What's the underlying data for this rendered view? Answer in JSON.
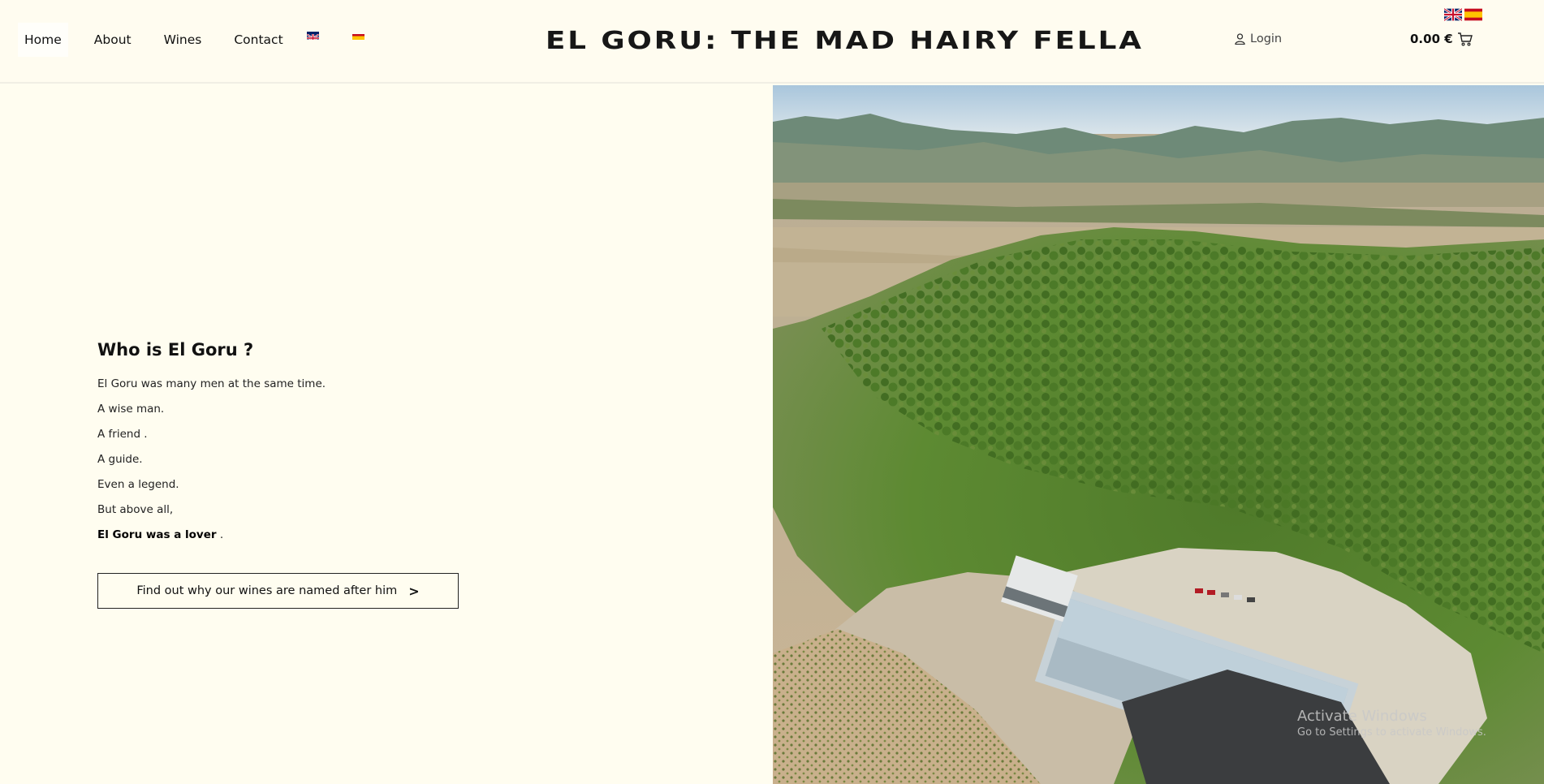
{
  "nav": {
    "items": [
      {
        "label": "Home",
        "active": true
      },
      {
        "label": "About",
        "active": false
      },
      {
        "label": "Wines",
        "active": false
      },
      {
        "label": "Contact",
        "active": false
      }
    ]
  },
  "site": {
    "title": "EL GORU: THE MAD HAIRY FELLA"
  },
  "account": {
    "login_label": "Login"
  },
  "cart": {
    "total": "0.00 €"
  },
  "content": {
    "heading": "Who is El Goru ?",
    "lines": [
      "El Goru was many men at the same time.",
      "A wise man.",
      "A friend .",
      "A guide.",
      "Even a legend.",
      "But above all,"
    ],
    "final_bold": "El Goru was a lover",
    "final_tail": " .",
    "cta_label": "Find out why our wines are named after him",
    "cta_arrow": ">"
  },
  "watermark": {
    "line1": "Activate Windows",
    "line2": "Go to Settings to activate Windows."
  },
  "colors": {
    "background": "#fffdf0",
    "text": "#111111",
    "accent": "#171717"
  },
  "icons": [
    "uk-flag-icon",
    "spain-flag-icon",
    "user-icon",
    "cart-icon",
    "chevron-right-icon"
  ]
}
